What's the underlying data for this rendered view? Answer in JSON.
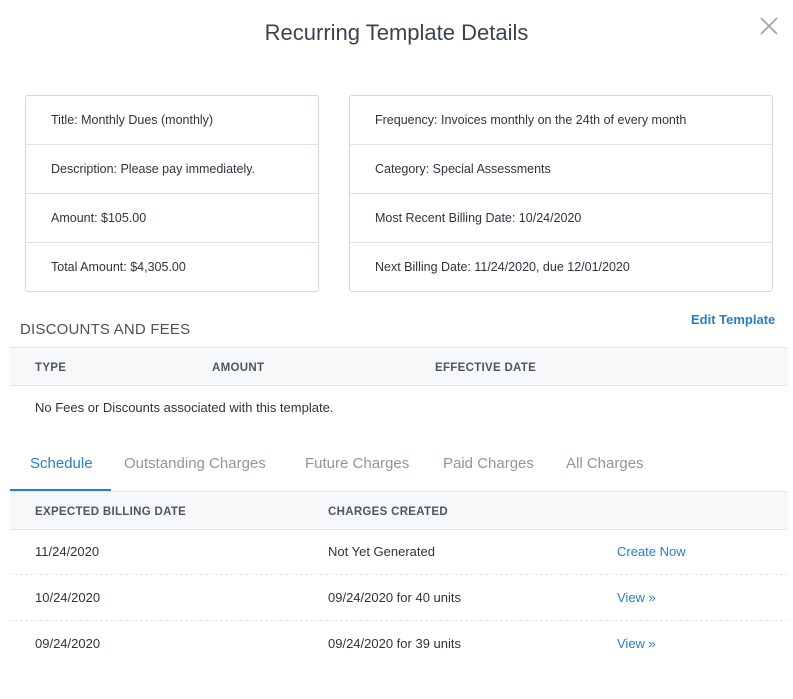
{
  "modal": {
    "title": "Recurring Template Details",
    "close_icon": "close-icon"
  },
  "details": {
    "left": [
      "Title: Monthly Dues (monthly)",
      "Description: Please pay immediately.",
      "Amount: $105.00",
      "Total Amount: $4,305.00"
    ],
    "right": [
      "Frequency: Invoices monthly on the 24th of every month",
      "Category: Special Assessments",
      "Most Recent Billing Date: 10/24/2020",
      "Next Billing Date: 11/24/2020, due 12/01/2020"
    ]
  },
  "fees": {
    "section_title": "DISCOUNTS AND FEES",
    "edit_label": "Edit Template",
    "headers": [
      "TYPE",
      "AMOUNT",
      "EFFECTIVE DATE"
    ],
    "empty_message": "No Fees or Discounts associated with this template."
  },
  "tabs": [
    "Schedule",
    "Outstanding Charges",
    "Future Charges",
    "Paid Charges",
    "All Charges"
  ],
  "active_tab": "Schedule",
  "schedule": {
    "headers": [
      "EXPECTED BILLING DATE",
      "CHARGES CREATED"
    ],
    "rows": [
      {
        "date": "11/24/2020",
        "charges": "Not Yet Generated",
        "action": "Create Now"
      },
      {
        "date": "10/24/2020",
        "charges": "09/24/2020 for 40 units",
        "action": "View »"
      },
      {
        "date": "09/24/2020",
        "charges": "09/24/2020 for 39 units",
        "action": "View »"
      }
    ]
  },
  "colors": {
    "accent": "#2a7dc5",
    "text": "#2d3440",
    "muted": "#8f969e",
    "border": "#d5d9de"
  }
}
